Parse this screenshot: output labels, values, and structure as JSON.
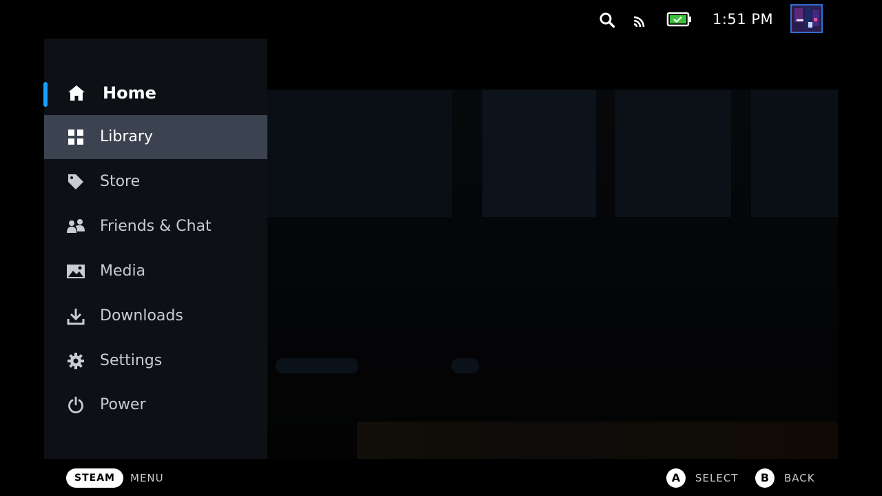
{
  "status_bar": {
    "time": "1:51 PM",
    "icons": [
      "search-icon",
      "wifi-icon",
      "battery-charging-icon"
    ],
    "battery_color": "#3cc03c"
  },
  "menu": {
    "accent_color": "#1a9fff",
    "selected_index": 1,
    "items": [
      {
        "label": "Home",
        "icon": "home-icon"
      },
      {
        "label": "Library",
        "icon": "library-grid-icon"
      },
      {
        "label": "Store",
        "icon": "tag-icon"
      },
      {
        "label": "Friends & Chat",
        "icon": "friends-icon"
      },
      {
        "label": "Media",
        "icon": "image-icon"
      },
      {
        "label": "Downloads",
        "icon": "download-icon"
      },
      {
        "label": "Settings",
        "icon": "gear-icon"
      },
      {
        "label": "Power",
        "icon": "power-icon"
      }
    ]
  },
  "hints": {
    "steam_button": "STEAM",
    "steam_action": "MENU",
    "a_button": "A",
    "a_action": "SELECT",
    "b_button": "B",
    "b_action": "BACK"
  }
}
